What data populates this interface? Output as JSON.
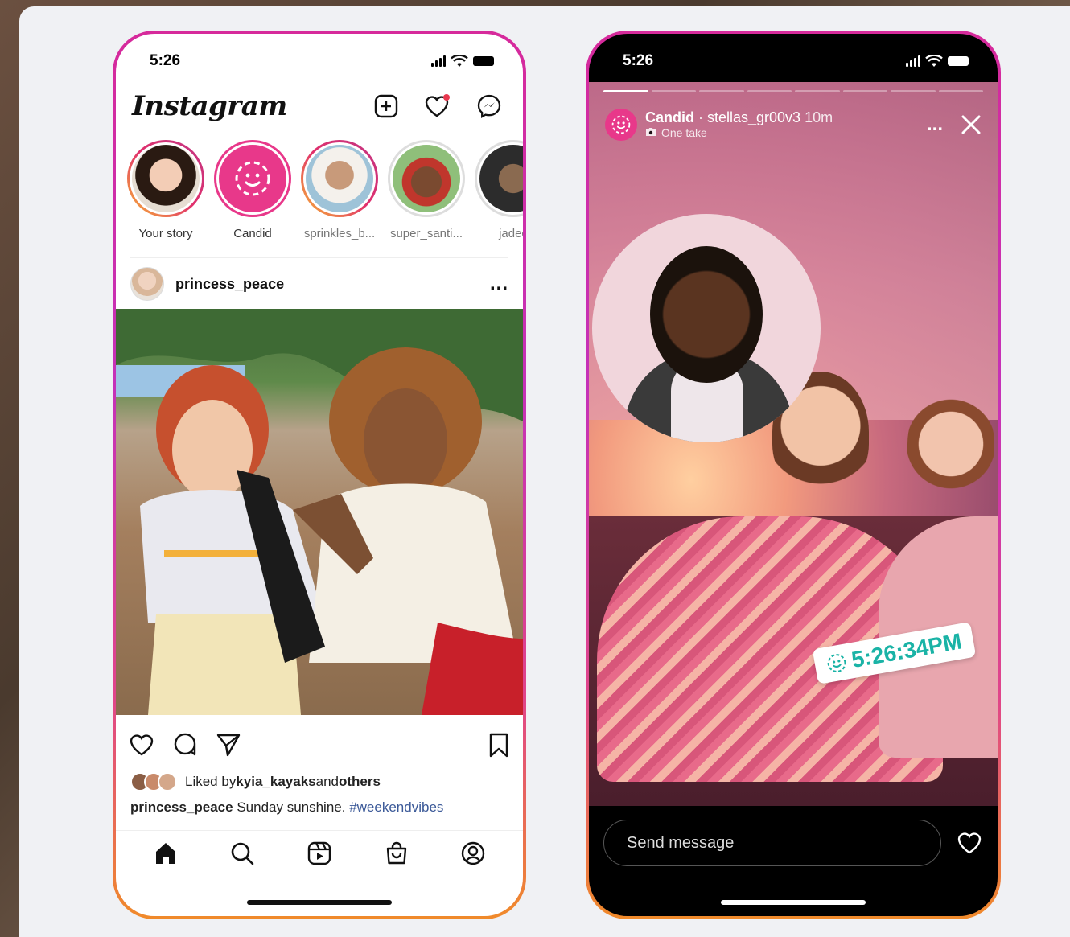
{
  "colors": {
    "brand_pink": "#e8388a",
    "timestamp_teal": "#1ab3a6",
    "hashtag_blue": "#3b5998"
  },
  "feed_phone": {
    "status_time": "5:26",
    "logo": "Instagram",
    "header_icons": [
      "new-post-icon",
      "heart-icon",
      "messenger-icon"
    ],
    "stories": [
      {
        "label": "Your story",
        "ring": "gold",
        "icon": "avatar"
      },
      {
        "label": "Candid",
        "ring": "pink",
        "icon": "candid-icon"
      },
      {
        "label": "sprinkles_b...",
        "ring": "gold",
        "icon": "avatar"
      },
      {
        "label": "super_santi...",
        "ring": "none",
        "icon": "avatar"
      },
      {
        "label": "jadec",
        "ring": "none",
        "icon": "avatar"
      }
    ],
    "post": {
      "username": "princess_peace",
      "more": "...",
      "likes_prefix": "Liked by ",
      "likes_user": "kyia_kayaks",
      "likes_mid": " and ",
      "likes_suffix": "others",
      "caption_user": "princess_peace",
      "caption_text": " Sunday sunshine. ",
      "caption_hashtag": "#weekendvibes"
    },
    "tabbar": [
      "home-icon",
      "search-icon",
      "reels-icon",
      "shop-icon",
      "profile-icon"
    ]
  },
  "story_phone": {
    "status_time": "5:26",
    "story_title": "Candid",
    "story_sep": " · ",
    "story_user": "stellas_gr00v3",
    "story_age": " 10m",
    "story_sub": "One take",
    "more": "...",
    "timestamp": "5:26:34PM",
    "message_placeholder": "Send message",
    "progress_segments": 8
  }
}
